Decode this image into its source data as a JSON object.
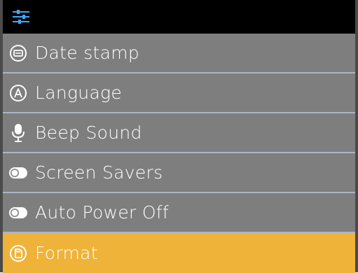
{
  "header": {
    "icon": "settings-sliders-icon",
    "accent_color": "#3fa9f5"
  },
  "menu": {
    "items": [
      {
        "label": "Date stamp",
        "icon": "date-stamp-icon",
        "selected": false
      },
      {
        "label": "Language",
        "icon": "language-icon",
        "selected": false
      },
      {
        "label": "Beep Sound",
        "icon": "microphone-icon",
        "selected": false
      },
      {
        "label": "Screen Savers",
        "icon": "toggle-icon",
        "selected": false
      },
      {
        "label": "Auto Power Off",
        "icon": "toggle-icon",
        "selected": false
      },
      {
        "label": "Format",
        "icon": "sd-card-icon",
        "selected": true
      }
    ],
    "selected_color": "#efb33a",
    "item_color": "#7e7e7e"
  }
}
